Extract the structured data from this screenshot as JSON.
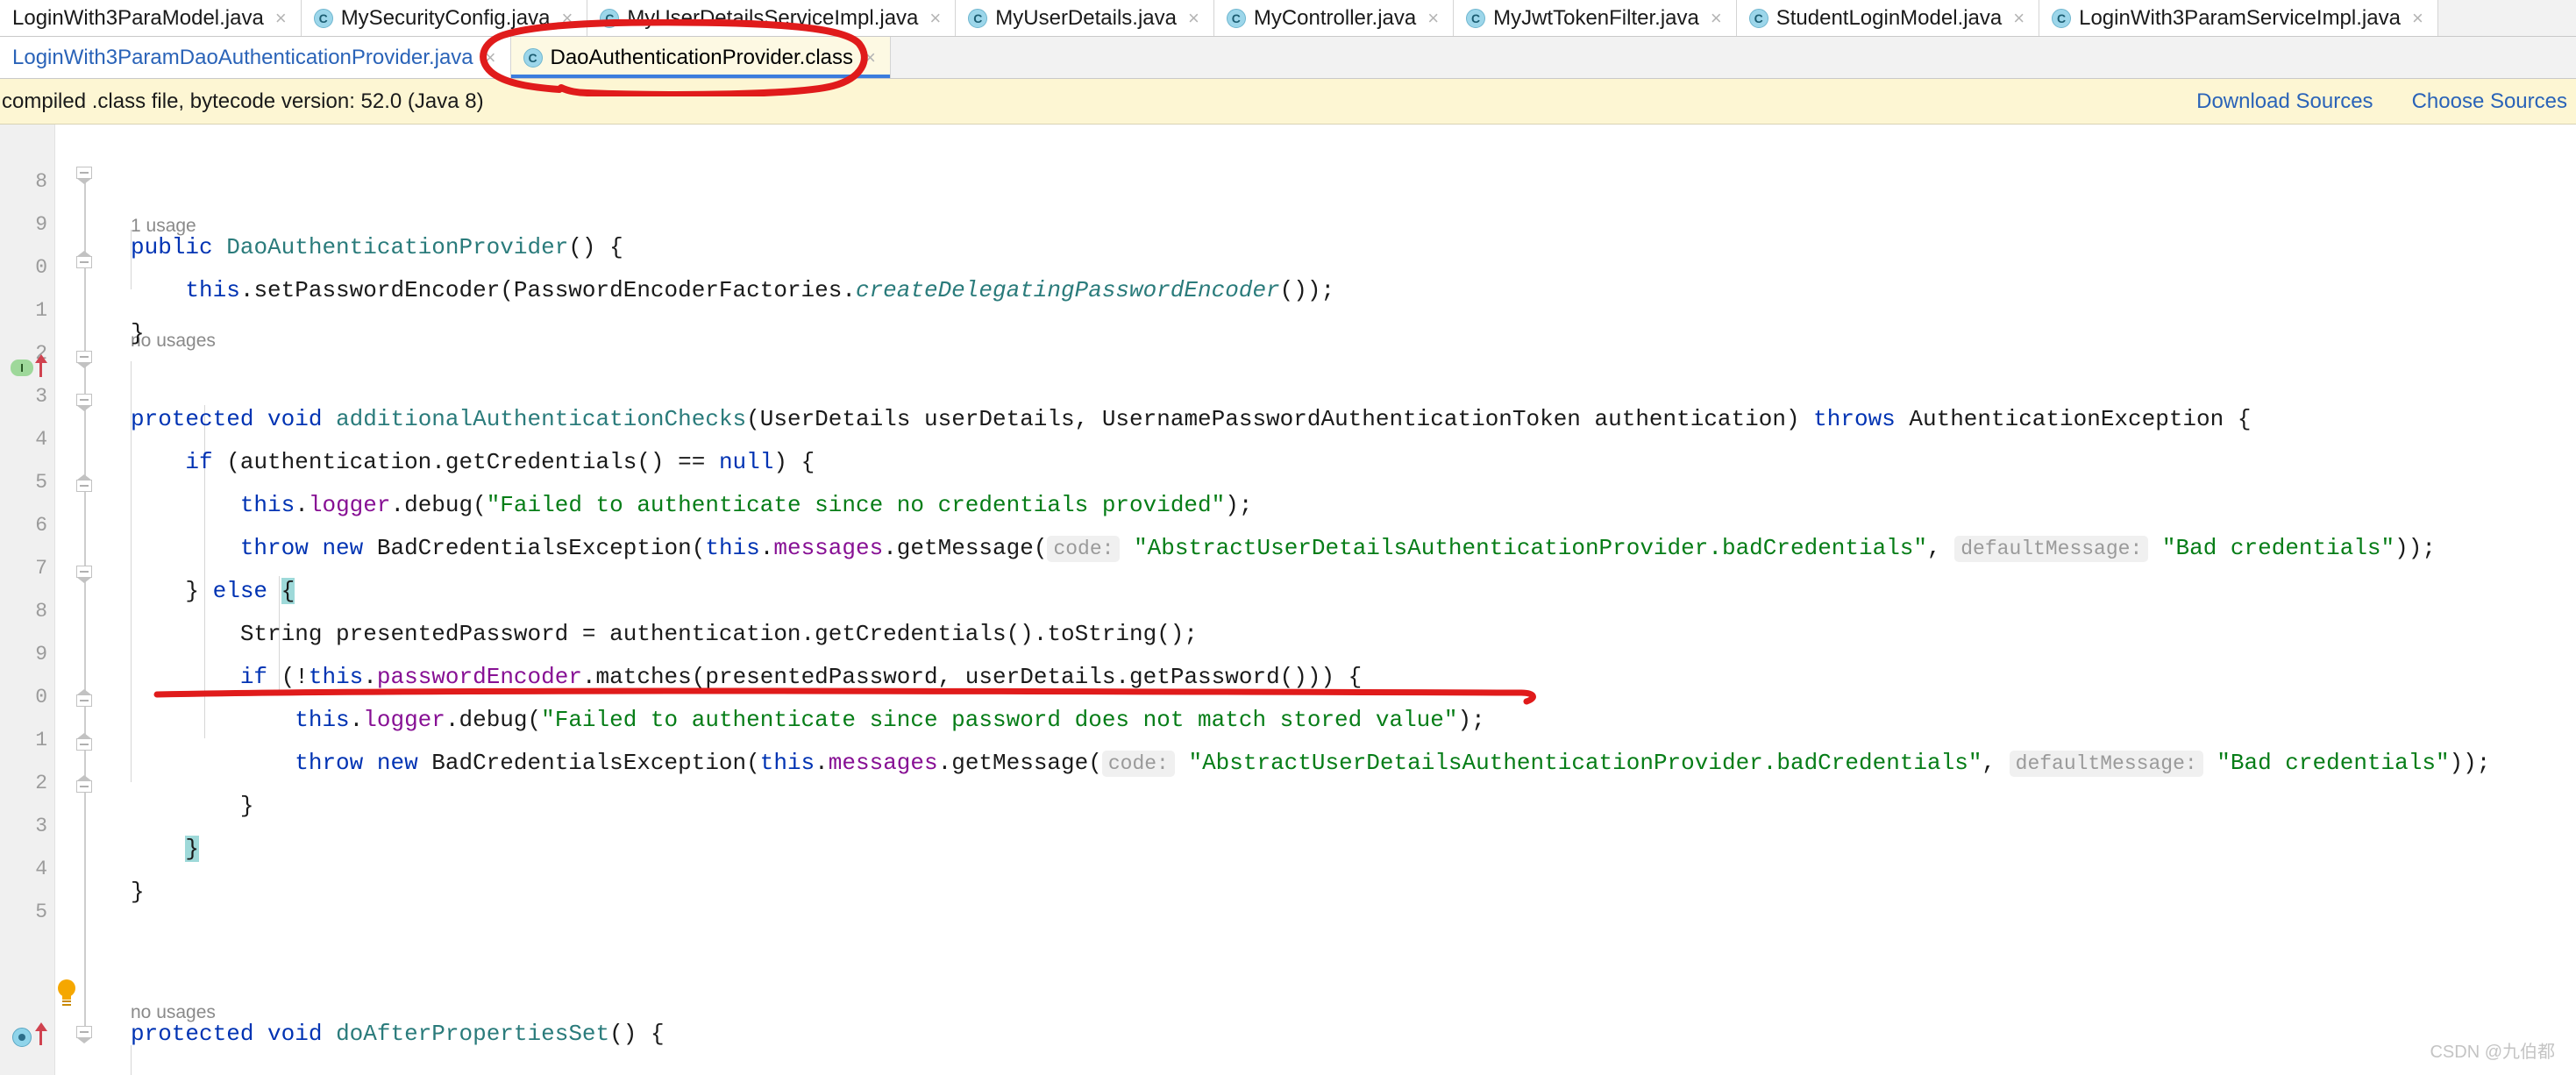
{
  "window": {
    "app": "IntelliJ IDEA",
    "watermark": "CSDN @九伯都"
  },
  "tabs_row1": [
    {
      "label": "LoginWith3ParaModel.java",
      "icon": "java-class-icon",
      "close": "×",
      "active": false
    },
    {
      "label": "MySecurityConfig.java",
      "icon": "java-class-icon",
      "close": "×",
      "active": false
    },
    {
      "label": "MyUserDetailsServiceImpl.java",
      "icon": "java-class-icon",
      "close": "×",
      "active": false
    },
    {
      "label": "MyUserDetails.java",
      "icon": "java-class-icon",
      "close": "×",
      "active": false
    },
    {
      "label": "MyController.java",
      "icon": "java-class-icon",
      "close": "×",
      "active": false
    },
    {
      "label": "MyJwtTokenFilter.java",
      "icon": "java-class-icon",
      "close": "×",
      "active": false
    },
    {
      "label": "StudentLoginModel.java",
      "icon": "java-class-icon",
      "close": "×",
      "active": false
    },
    {
      "label": "LoginWith3ParamServiceImpl.java",
      "icon": "java-class-icon",
      "close": "×",
      "active": false
    }
  ],
  "tabs_row2": [
    {
      "label": "LoginWith3ParamDaoAuthenticationProvider.java",
      "icon": "none",
      "close": "×",
      "active": false
    },
    {
      "label": "DaoAuthenticationProvider.class",
      "icon": "java-class-icon",
      "close": "×",
      "active": true
    }
  ],
  "banner": {
    "message": "compiled .class file, bytecode version: 52.0 (Java 8)",
    "download_sources_label": "Download Sources",
    "choose_sources_label": "Choose Sources"
  },
  "editor": {
    "line_numbers": [
      "8",
      "9",
      "0",
      "1",
      "2",
      "3",
      "4",
      "5",
      "6",
      "7",
      "8",
      "9",
      "0",
      "1",
      "2",
      "3",
      "4",
      "5"
    ],
    "usage_hints": [
      {
        "text": "1 usage"
      },
      {
        "text": "no usages"
      },
      {
        "text": "no usages"
      }
    ],
    "code_lines": [
      {
        "id": "l_ctor",
        "text": "public DaoAuthenticationProvider() {"
      },
      {
        "id": "l_setenc",
        "text": "    this.setPasswordEncoder(PasswordEncoderFactories.createDelegatingPasswordEncoder());"
      },
      {
        "id": "l_close1",
        "text": "}"
      },
      {
        "id": "l_addchecks",
        "text": "protected void additionalAuthenticationChecks(UserDetails userDetails, UsernamePasswordAuthenticationToken authentication) throws AuthenticationException {"
      },
      {
        "id": "l_ifnull",
        "text": "    if (authentication.getCredentials() == null) {"
      },
      {
        "id": "l_dbg1",
        "text": "        this.logger.debug(\"Failed to authenticate since no credentials provided\");"
      },
      {
        "id": "l_throw1",
        "text": "        throw new BadCredentialsException(this.messages.getMessage( code: \"AbstractUserDetailsAuthenticationProvider.badCredentials\",  defaultMessage: \"Bad credentials\"));"
      },
      {
        "id": "l_else",
        "text": "    } else {"
      },
      {
        "id": "l_presented",
        "text": "        String presentedPassword = authentication.getCredentials().toString();"
      },
      {
        "id": "l_ifmatch",
        "text": "        if (!this.passwordEncoder.matches(presentedPassword, userDetails.getPassword())) {"
      },
      {
        "id": "l_dbg2",
        "text": "            this.logger.debug(\"Failed to authenticate since password does not match stored value\");"
      },
      {
        "id": "l_throw2",
        "text": "            throw new BadCredentialsException(this.messages.getMessage( code: \"AbstractUserDetailsAuthenticationProvider.badCredentials\",  defaultMessage: \"Bad credentials\"));"
      },
      {
        "id": "l_close2",
        "text": "        }"
      },
      {
        "id": "l_close3",
        "text": "    }"
      },
      {
        "id": "l_close4",
        "text": "}"
      },
      {
        "id": "l_doafter",
        "text": "protected void doAfterPropertiesSet() {"
      }
    ],
    "inlay_hints": [
      {
        "label": "code:"
      },
      {
        "label": "defaultMessage:"
      },
      {
        "label": "code:"
      },
      {
        "label": "defaultMessage:"
      }
    ],
    "strings": {
      "bad_credentials_key": "\"AbstractUserDetailsAuthenticationProvider.badCredentials\"",
      "bad_credentials_default": "\"Bad credentials\"",
      "no_credentials_msg": "\"Failed to authenticate since no credentials provided\"",
      "password_mismatch_msg": "\"Failed to authenticate since password does not match stored value\""
    },
    "gutter_markers": [
      {
        "type": "implemented-badge",
        "label": "I"
      },
      {
        "type": "override-arrow-icon"
      },
      {
        "type": "intention-bulb-icon"
      },
      {
        "type": "override-marker-icon"
      }
    ]
  },
  "annotations": {
    "tab_circle_color": "#e01b1b",
    "underline_color": "#e01b1b"
  },
  "colors": {
    "keyword": "#0033b3",
    "string": "#067d17",
    "type": "#2a7b7b",
    "field": "#871094",
    "hint_bg": "#f0f0f0",
    "banner_bg": "#fdf6d3",
    "link": "#2a63b8",
    "caret_line_bg": "#fcfbe8",
    "brace_match": "#9ed9d9"
  }
}
